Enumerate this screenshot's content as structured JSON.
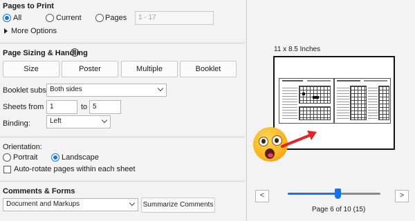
{
  "pages_to_print": {
    "title": "Pages to Print",
    "all_label": "All",
    "current_label": "Current",
    "pages_label": "Pages",
    "pages_placeholder": "1 - 17",
    "more_options_label": "More Options",
    "selected": "All"
  },
  "sizing": {
    "title": "Page Sizing & Handling",
    "info_glyph": "i",
    "tabs": [
      "Size",
      "Poster",
      "Multiple",
      "Booklet"
    ],
    "booklet_subset_label": "Booklet subset:",
    "booklet_subset_value": "Both sides",
    "sheets_from_label": "Sheets from",
    "sheets_from_value": "1",
    "sheets_to_label": "to",
    "sheets_to_value": "5",
    "binding_label": "Binding:",
    "binding_value": "Left"
  },
  "orientation": {
    "title": "Orientation:",
    "portrait_label": "Portrait",
    "landscape_label": "Landscape",
    "selected": "Landscape",
    "autorotate_label": "Auto-rotate pages within each sheet",
    "autorotate_checked": false
  },
  "comments": {
    "title": "Comments & Forms",
    "dropdown_value": "Document and Markups",
    "summarize_label": "Summarize Comments"
  },
  "preview": {
    "size_label": "11 x 8.5 Inches",
    "prev_glyph": "<",
    "next_glyph": ">",
    "page_status": "Page 6 of 10 (15)",
    "slider_fraction": 0.54
  },
  "colors": {
    "accent": "#1473e6",
    "arrow": "#e0262b"
  },
  "icons": [
    "chevron-right-icon",
    "info-icon",
    "chevron-down-icon",
    "shocked-emoji-icon",
    "red-arrow-icon"
  ]
}
